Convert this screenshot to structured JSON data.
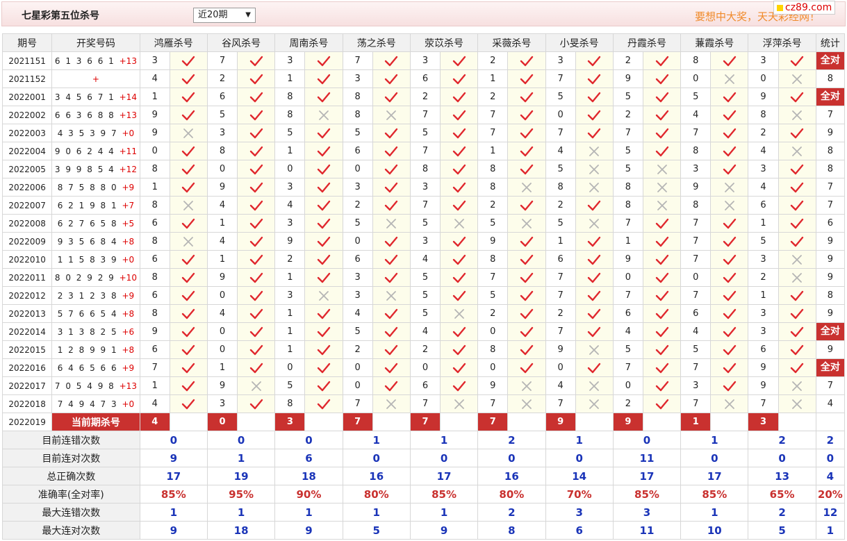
{
  "header": {
    "title": "七星彩第五位杀号",
    "select_value": "近20期",
    "select_arrow": "▼",
    "promo": "要想中大奖，天天彩经网！",
    "logo": "cz89.com"
  },
  "table": {
    "headers": [
      "期号",
      "开奖号码",
      "鸿雁杀号",
      "谷风杀号",
      "周南杀号",
      "荡之杀号",
      "荥苡杀号",
      "采薇杀号",
      "小旻杀号",
      "丹霞杀号",
      "蒹霞杀号",
      "浮萍杀号",
      "统计"
    ],
    "all_ok_label": "全对",
    "rows": [
      {
        "issue": "2021151",
        "nums": "6 1 3 6 6 1",
        "sum": "+13",
        "cells": [
          [
            3,
            1
          ],
          [
            7,
            1
          ],
          [
            3,
            1
          ],
          [
            7,
            1
          ],
          [
            3,
            1
          ],
          [
            2,
            1
          ],
          [
            3,
            1
          ],
          [
            2,
            1
          ],
          [
            8,
            1
          ],
          [
            3,
            1
          ]
        ],
        "stat": "全对"
      },
      {
        "issue": "2021152",
        "nums": "",
        "sum": "+",
        "cells": [
          [
            4,
            1
          ],
          [
            2,
            1
          ],
          [
            1,
            1
          ],
          [
            3,
            1
          ],
          [
            6,
            1
          ],
          [
            1,
            1
          ],
          [
            7,
            1
          ],
          [
            9,
            1
          ],
          [
            0,
            0
          ],
          [
            0,
            0
          ]
        ],
        "stat": "8"
      },
      {
        "issue": "2022001",
        "nums": "3 4 5 6 7 1",
        "sum": "+14",
        "cells": [
          [
            1,
            1
          ],
          [
            6,
            1
          ],
          [
            8,
            1
          ],
          [
            8,
            1
          ],
          [
            2,
            1
          ],
          [
            2,
            1
          ],
          [
            5,
            1
          ],
          [
            5,
            1
          ],
          [
            5,
            1
          ],
          [
            9,
            1
          ]
        ],
        "stat": "全对"
      },
      {
        "issue": "2022002",
        "nums": "6 6 3 6 8 8",
        "sum": "+13",
        "cells": [
          [
            9,
            1
          ],
          [
            5,
            1
          ],
          [
            8,
            0
          ],
          [
            8,
            0
          ],
          [
            7,
            1
          ],
          [
            7,
            1
          ],
          [
            0,
            1
          ],
          [
            2,
            1
          ],
          [
            4,
            1
          ],
          [
            8,
            0
          ]
        ],
        "stat": "7"
      },
      {
        "issue": "2022003",
        "nums": "4 3 5 3 9 7",
        "sum": "+0",
        "cells": [
          [
            9,
            0
          ],
          [
            3,
            1
          ],
          [
            5,
            1
          ],
          [
            5,
            1
          ],
          [
            5,
            1
          ],
          [
            7,
            1
          ],
          [
            7,
            1
          ],
          [
            7,
            1
          ],
          [
            7,
            1
          ],
          [
            2,
            1
          ]
        ],
        "stat": "9"
      },
      {
        "issue": "2022004",
        "nums": "9 0 6 2 4 4",
        "sum": "+11",
        "cells": [
          [
            0,
            1
          ],
          [
            8,
            1
          ],
          [
            1,
            1
          ],
          [
            6,
            1
          ],
          [
            7,
            1
          ],
          [
            1,
            1
          ],
          [
            4,
            0
          ],
          [
            5,
            1
          ],
          [
            8,
            1
          ],
          [
            4,
            0
          ]
        ],
        "stat": "8"
      },
      {
        "issue": "2022005",
        "nums": "3 9 9 8 5 4",
        "sum": "+12",
        "cells": [
          [
            8,
            1
          ],
          [
            0,
            1
          ],
          [
            0,
            1
          ],
          [
            0,
            1
          ],
          [
            8,
            1
          ],
          [
            8,
            1
          ],
          [
            5,
            0
          ],
          [
            5,
            0
          ],
          [
            3,
            1
          ],
          [
            3,
            1
          ]
        ],
        "stat": "8"
      },
      {
        "issue": "2022006",
        "nums": "8 7 5 8 8 0",
        "sum": "+9",
        "cells": [
          [
            1,
            1
          ],
          [
            9,
            1
          ],
          [
            3,
            1
          ],
          [
            3,
            1
          ],
          [
            3,
            1
          ],
          [
            8,
            0
          ],
          [
            8,
            0
          ],
          [
            8,
            0
          ],
          [
            9,
            0
          ],
          [
            4,
            1
          ]
        ],
        "stat": "7"
      },
      {
        "issue": "2022007",
        "nums": "6 2 1 9 8 1",
        "sum": "+7",
        "cells": [
          [
            8,
            0
          ],
          [
            4,
            1
          ],
          [
            4,
            1
          ],
          [
            2,
            1
          ],
          [
            7,
            1
          ],
          [
            2,
            1
          ],
          [
            2,
            1
          ],
          [
            8,
            0
          ],
          [
            8,
            0
          ],
          [
            6,
            1
          ]
        ],
        "stat": "7"
      },
      {
        "issue": "2022008",
        "nums": "6 2 7 6 5 8",
        "sum": "+5",
        "cells": [
          [
            6,
            1
          ],
          [
            1,
            1
          ],
          [
            3,
            1
          ],
          [
            5,
            0
          ],
          [
            5,
            0
          ],
          [
            5,
            0
          ],
          [
            5,
            0
          ],
          [
            7,
            1
          ],
          [
            7,
            1
          ],
          [
            1,
            1
          ]
        ],
        "stat": "6"
      },
      {
        "issue": "2022009",
        "nums": "9 3 5 6 8 4",
        "sum": "+8",
        "cells": [
          [
            8,
            0
          ],
          [
            4,
            1
          ],
          [
            9,
            1
          ],
          [
            0,
            1
          ],
          [
            3,
            1
          ],
          [
            9,
            1
          ],
          [
            1,
            1
          ],
          [
            1,
            1
          ],
          [
            7,
            1
          ],
          [
            5,
            1
          ]
        ],
        "stat": "9"
      },
      {
        "issue": "2022010",
        "nums": "1 1 5 8 3 9",
        "sum": "+0",
        "cells": [
          [
            6,
            1
          ],
          [
            1,
            1
          ],
          [
            2,
            1
          ],
          [
            6,
            1
          ],
          [
            4,
            1
          ],
          [
            8,
            1
          ],
          [
            6,
            1
          ],
          [
            9,
            1
          ],
          [
            7,
            1
          ],
          [
            3,
            0
          ]
        ],
        "stat": "9"
      },
      {
        "issue": "2022011",
        "nums": "8 0 2 9 2 9",
        "sum": "+10",
        "cells": [
          [
            8,
            1
          ],
          [
            9,
            1
          ],
          [
            1,
            1
          ],
          [
            3,
            1
          ],
          [
            5,
            1
          ],
          [
            7,
            1
          ],
          [
            7,
            1
          ],
          [
            0,
            1
          ],
          [
            0,
            1
          ],
          [
            2,
            0
          ]
        ],
        "stat": "9"
      },
      {
        "issue": "2022012",
        "nums": "2 3 1 2 3 8",
        "sum": "+9",
        "cells": [
          [
            6,
            1
          ],
          [
            0,
            1
          ],
          [
            3,
            0
          ],
          [
            3,
            0
          ],
          [
            5,
            1
          ],
          [
            5,
            1
          ],
          [
            7,
            1
          ],
          [
            7,
            1
          ],
          [
            7,
            1
          ],
          [
            1,
            1
          ]
        ],
        "stat": "8"
      },
      {
        "issue": "2022013",
        "nums": "5 7 6 6 5 4",
        "sum": "+8",
        "cells": [
          [
            8,
            1
          ],
          [
            4,
            1
          ],
          [
            1,
            1
          ],
          [
            4,
            1
          ],
          [
            5,
            0
          ],
          [
            2,
            1
          ],
          [
            2,
            1
          ],
          [
            6,
            1
          ],
          [
            6,
            1
          ],
          [
            3,
            1
          ]
        ],
        "stat": "9"
      },
      {
        "issue": "2022014",
        "nums": "3 1 3 8 2 5",
        "sum": "+6",
        "cells": [
          [
            9,
            1
          ],
          [
            0,
            1
          ],
          [
            1,
            1
          ],
          [
            5,
            1
          ],
          [
            4,
            1
          ],
          [
            0,
            1
          ],
          [
            7,
            1
          ],
          [
            4,
            1
          ],
          [
            4,
            1
          ],
          [
            3,
            1
          ]
        ],
        "stat": "全对"
      },
      {
        "issue": "2022015",
        "nums": "1 2 8 9 9 1",
        "sum": "+8",
        "cells": [
          [
            6,
            1
          ],
          [
            0,
            1
          ],
          [
            1,
            1
          ],
          [
            2,
            1
          ],
          [
            2,
            1
          ],
          [
            8,
            1
          ],
          [
            9,
            0
          ],
          [
            5,
            1
          ],
          [
            5,
            1
          ],
          [
            6,
            1
          ]
        ],
        "stat": "9"
      },
      {
        "issue": "2022016",
        "nums": "6 4 6 5 6 6",
        "sum": "+9",
        "cells": [
          [
            7,
            1
          ],
          [
            1,
            1
          ],
          [
            0,
            1
          ],
          [
            0,
            1
          ],
          [
            0,
            1
          ],
          [
            0,
            1
          ],
          [
            0,
            1
          ],
          [
            7,
            1
          ],
          [
            7,
            1
          ],
          [
            9,
            1
          ]
        ],
        "stat": "全对"
      },
      {
        "issue": "2022017",
        "nums": "7 0 5 4 9 8",
        "sum": "+13",
        "cells": [
          [
            1,
            1
          ],
          [
            9,
            0
          ],
          [
            5,
            1
          ],
          [
            0,
            1
          ],
          [
            6,
            1
          ],
          [
            9,
            0
          ],
          [
            4,
            0
          ],
          [
            0,
            1
          ],
          [
            3,
            1
          ],
          [
            9,
            0
          ]
        ],
        "stat": "7"
      },
      {
        "issue": "2022018",
        "nums": "7 4 9 4 7 3",
        "sum": "+0",
        "cells": [
          [
            4,
            1
          ],
          [
            3,
            1
          ],
          [
            8,
            1
          ],
          [
            7,
            0
          ],
          [
            7,
            0
          ],
          [
            7,
            0
          ],
          [
            7,
            0
          ],
          [
            2,
            1
          ],
          [
            7,
            0
          ],
          [
            7,
            0
          ]
        ],
        "stat": "4"
      }
    ],
    "current": {
      "issue": "2022019",
      "label": "当前期杀号",
      "values": [
        "4",
        "0",
        "3",
        "7",
        "7",
        "7",
        "9",
        "9",
        "1",
        "3"
      ]
    },
    "stats": [
      {
        "label": "目前连错次数",
        "values": [
          "0",
          "0",
          "0",
          "1",
          "1",
          "2",
          "1",
          "0",
          "1",
          "2",
          "2"
        ],
        "rate": false
      },
      {
        "label": "目前连对次数",
        "values": [
          "9",
          "1",
          "6",
          "0",
          "0",
          "0",
          "0",
          "11",
          "0",
          "0",
          "0"
        ],
        "rate": false
      },
      {
        "label": "总正确次数",
        "values": [
          "17",
          "19",
          "18",
          "16",
          "17",
          "16",
          "14",
          "17",
          "17",
          "13",
          "4"
        ],
        "rate": false
      },
      {
        "label": "准确率(全对率)",
        "values": [
          "85%",
          "95%",
          "90%",
          "80%",
          "85%",
          "80%",
          "70%",
          "85%",
          "85%",
          "65%",
          "20%"
        ],
        "rate": true
      },
      {
        "label": "最大连错次数",
        "values": [
          "1",
          "1",
          "1",
          "1",
          "1",
          "2",
          "3",
          "3",
          "1",
          "2",
          "12"
        ],
        "rate": false
      },
      {
        "label": "最大连对次数",
        "values": [
          "9",
          "18",
          "9",
          "5",
          "9",
          "8",
          "6",
          "11",
          "10",
          "5",
          "1"
        ],
        "rate": false
      }
    ]
  }
}
